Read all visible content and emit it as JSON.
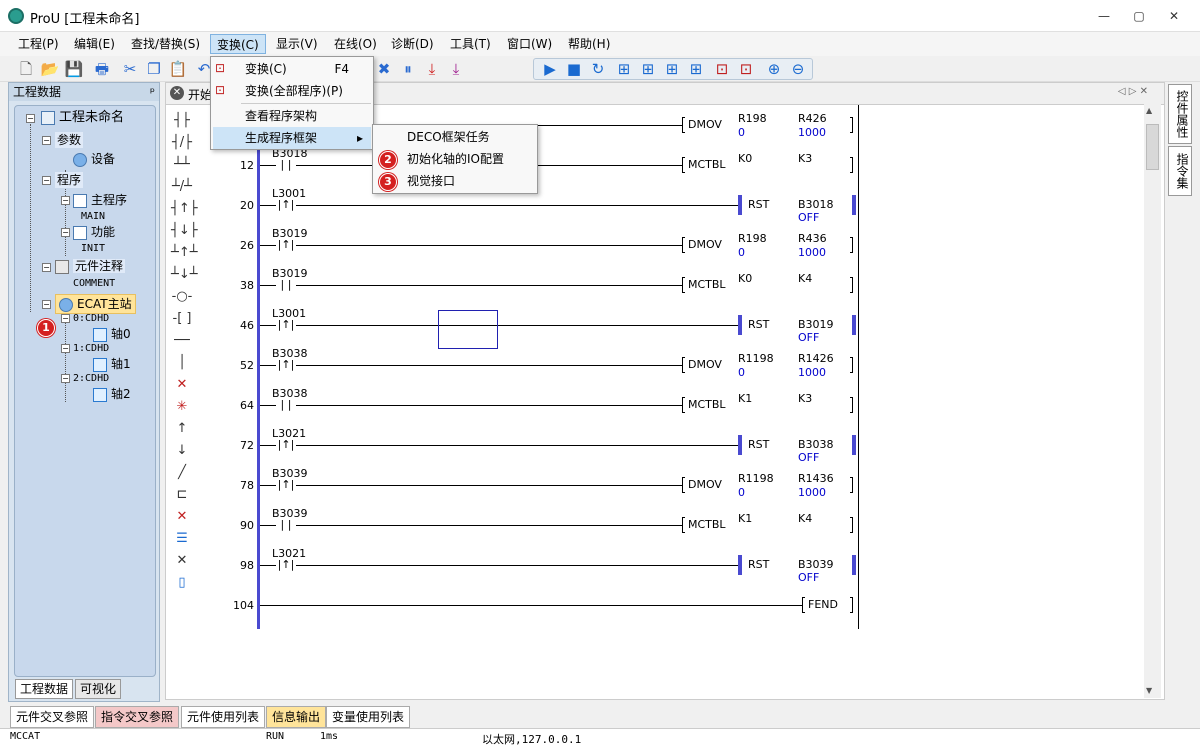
{
  "window": {
    "title": "ProU [工程未命名]",
    "minimize": "—",
    "maximize": "▢",
    "close": "✕"
  },
  "menu": [
    "工程(P)",
    "编辑(E)",
    "查找/替换(S)",
    "变换(C)",
    "显示(V)",
    "在线(O)",
    "诊断(D)",
    "工具(T)",
    "窗口(W)",
    "帮助(H)"
  ],
  "left_panel": {
    "title": "工程数据",
    "pin": "ᵖ",
    "tree": {
      "root": "工程未命名",
      "params": "参数",
      "device": "设备",
      "program": "程序",
      "main_program": "主程序",
      "main": "MAIN",
      "function": "功能",
      "init": "INIT",
      "comment_group": "元件注释",
      "comment": "COMMENT",
      "ecat": "ECAT主站",
      "cdhd0": "0:CDHD",
      "axis0": "轴0",
      "cdhd1": "1:CDHD",
      "axis1": "轴1",
      "cdhd2": "2:CDHD",
      "axis2": "轴2"
    },
    "tabs": [
      "工程数据",
      "可视化"
    ]
  },
  "editor": {
    "tab": "开始"
  },
  "dropdown": {
    "items": [
      {
        "label": "变换(C)",
        "shortcut": "F4"
      },
      {
        "label": "变换(全部程序)(P)",
        "shortcut": ""
      },
      {
        "label": "查看程序架构",
        "shortcut": ""
      },
      {
        "label": "生成程序框架",
        "shortcut": "▸"
      }
    ],
    "submenu": [
      "DECO框架任务",
      "初始化轴的IO配置",
      "视觉接口"
    ]
  },
  "badges": [
    "1",
    "2",
    "3"
  ],
  "ladder": {
    "rungs": [
      {
        "num": "",
        "contact": "",
        "instr": "DMOV",
        "a1": "R198",
        "a1v": "0",
        "a2": "R426",
        "a2v": "1000"
      },
      {
        "num": "12",
        "contact": "B3018",
        "instr": "MCTBL",
        "a1": "K0",
        "a1v": "",
        "a2": "K3",
        "a2v": ""
      },
      {
        "num": "20",
        "contact": "L3001",
        "instr": "RST",
        "a1": "",
        "a1v": "",
        "a2": "B3018",
        "a2v": "OFF"
      },
      {
        "num": "26",
        "contact": "B3019",
        "instr": "DMOV",
        "a1": "R198",
        "a1v": "0",
        "a2": "R436",
        "a2v": "1000"
      },
      {
        "num": "38",
        "contact": "B3019",
        "instr": "MCTBL",
        "a1": "K0",
        "a1v": "",
        "a2": "K4",
        "a2v": ""
      },
      {
        "num": "46",
        "contact": "L3001",
        "instr": "RST",
        "a1": "",
        "a1v": "",
        "a2": "B3019",
        "a2v": "OFF"
      },
      {
        "num": "52",
        "contact": "B3038",
        "instr": "DMOV",
        "a1": "R1198",
        "a1v": "0",
        "a2": "R1426",
        "a2v": "1000"
      },
      {
        "num": "64",
        "contact": "B3038",
        "instr": "MCTBL",
        "a1": "K1",
        "a1v": "",
        "a2": "K3",
        "a2v": ""
      },
      {
        "num": "72",
        "contact": "L3021",
        "instr": "RST",
        "a1": "",
        "a1v": "",
        "a2": "B3038",
        "a2v": "OFF"
      },
      {
        "num": "78",
        "contact": "B3039",
        "instr": "DMOV",
        "a1": "R1198",
        "a1v": "0",
        "a2": "R1436",
        "a2v": "1000"
      },
      {
        "num": "90",
        "contact": "B3039",
        "instr": "MCTBL",
        "a1": "K1",
        "a1v": "",
        "a2": "K4",
        "a2v": ""
      },
      {
        "num": "98",
        "contact": "L3021",
        "instr": "RST",
        "a1": "",
        "a1v": "",
        "a2": "B3039",
        "a2v": "OFF"
      },
      {
        "num": "104",
        "contact": "",
        "instr": "FEND",
        "a1": "",
        "a1v": "",
        "a2": "",
        "a2v": ""
      }
    ]
  },
  "right_tabs": [
    "控件属性",
    "指令集"
  ],
  "bottom_tabs": [
    "元件交叉参照",
    "指令交叉参照",
    "元件使用列表",
    "信息输出",
    "变量使用列表"
  ],
  "status": {
    "left": "MCCAT",
    "run": "RUN",
    "scan": "1ms",
    "network": "以太网,127.0.0.1"
  },
  "colors": {
    "accent": "#4a4ad0",
    "badge": "#d42020",
    "highlight": "#cde4f7",
    "value": "#0000cc"
  }
}
